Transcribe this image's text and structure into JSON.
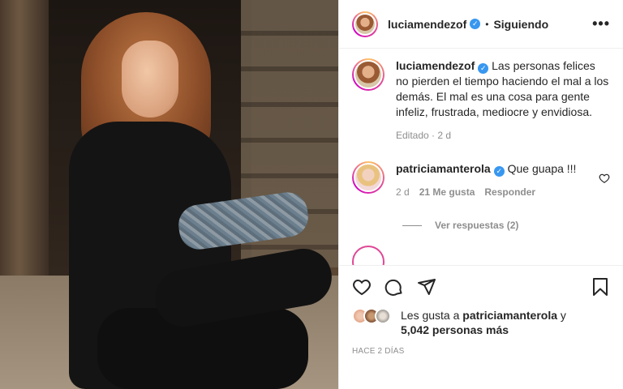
{
  "post": {
    "username": "luciamendezof",
    "follow_status": "Siguiendo",
    "dot": "•",
    "more_icon": "more-horizontal-icon"
  },
  "caption": {
    "username": "luciamendezof",
    "text": "Las personas felices no pierden el tiempo haciendo el mal a los demás. El mal es una cosa para gente infeliz, frustrada, mediocre y envidiosa.",
    "edited": "Editado",
    "time": "2 d"
  },
  "comment": {
    "username": "patriciamanterola",
    "text": "Que guapa !!!",
    "time": "2 d",
    "likes": "21 Me gusta",
    "reply": "Responder",
    "view_replies": "Ver respuestas (2)"
  },
  "likes": {
    "prefix": "Les gusta a",
    "user": "patriciamanterola",
    "connector": "y",
    "others": "5,042 personas más"
  },
  "date": "HACE 2 DÍAS",
  "colors": {
    "verified": "#3897f0",
    "meta": "#8e8e8e",
    "text": "#262626"
  }
}
